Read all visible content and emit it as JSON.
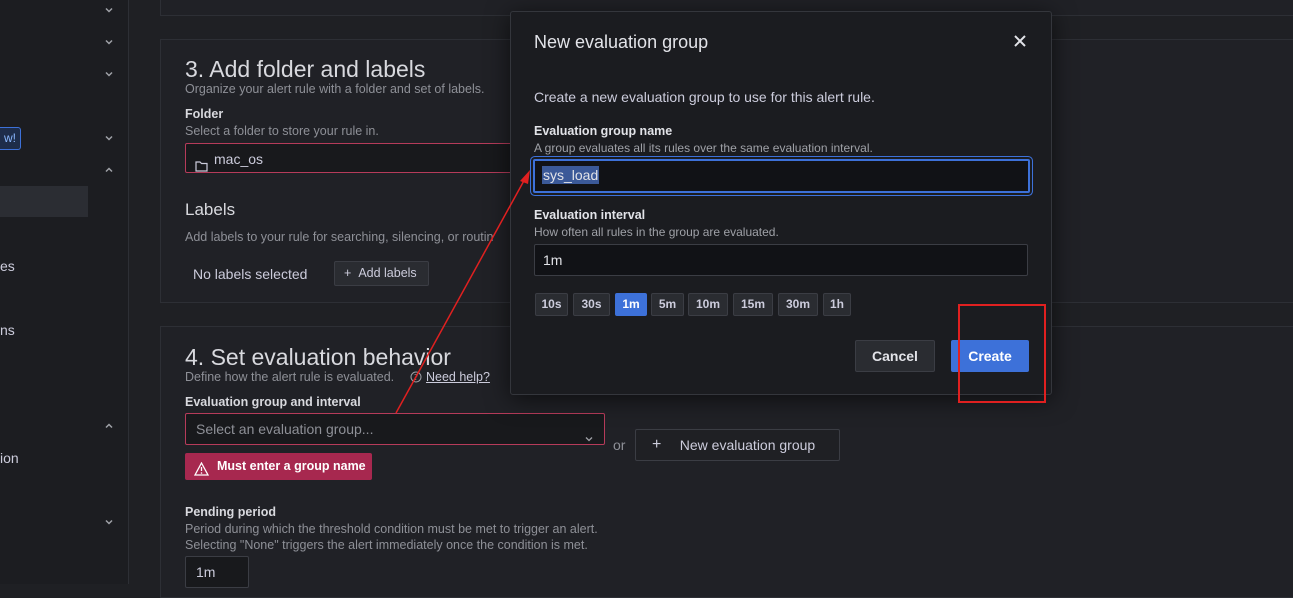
{
  "sidebar": {
    "badge": "w!",
    "labels": [
      "es",
      "ns",
      "ion"
    ]
  },
  "section3": {
    "title": "3. Add folder and labels",
    "subtitle": "Organize your alert rule with a folder and set of labels.",
    "folder_label": "Folder",
    "folder_help": "Select a folder to store your rule in.",
    "folder_value": "mac_os",
    "labels_title": "Labels",
    "labels_help": "Add labels to your rule for searching, silencing, or routin",
    "no_labels": "No labels selected",
    "add_labels": "Add labels"
  },
  "section4": {
    "title": "4. Set evaluation behavior",
    "subtitle": "Define how the alert rule is evaluated.",
    "help_link": "Need help?",
    "group_label": "Evaluation group and interval",
    "group_placeholder": "Select an evaluation group...",
    "or": "or",
    "new_group_button": "New evaluation group",
    "error": "Must enter a group name",
    "pending_label": "Pending period",
    "pending_help1": "Period during which the threshold condition must be met to trigger an alert.",
    "pending_help2": "Selecting \"None\" triggers the alert immediately once the condition is met.",
    "pending_value": "1m"
  },
  "modal": {
    "title": "New evaluation group",
    "description": "Create a new evaluation group to use for this alert rule.",
    "name_label": "Evaluation group name",
    "name_help": "A group evaluates all its rules over the same evaluation interval.",
    "name_value": "sys_load",
    "interval_label": "Evaluation interval",
    "interval_help": "How often all rules in the group are evaluated.",
    "interval_value": "1m",
    "chips": [
      "10s",
      "30s",
      "1m",
      "5m",
      "10m",
      "15m",
      "30m",
      "1h"
    ],
    "active_chip": "1m",
    "cancel": "Cancel",
    "create": "Create"
  },
  "colors": {
    "accent": "#3d71d9",
    "error": "#a7284f",
    "annotation": "#e02020"
  }
}
